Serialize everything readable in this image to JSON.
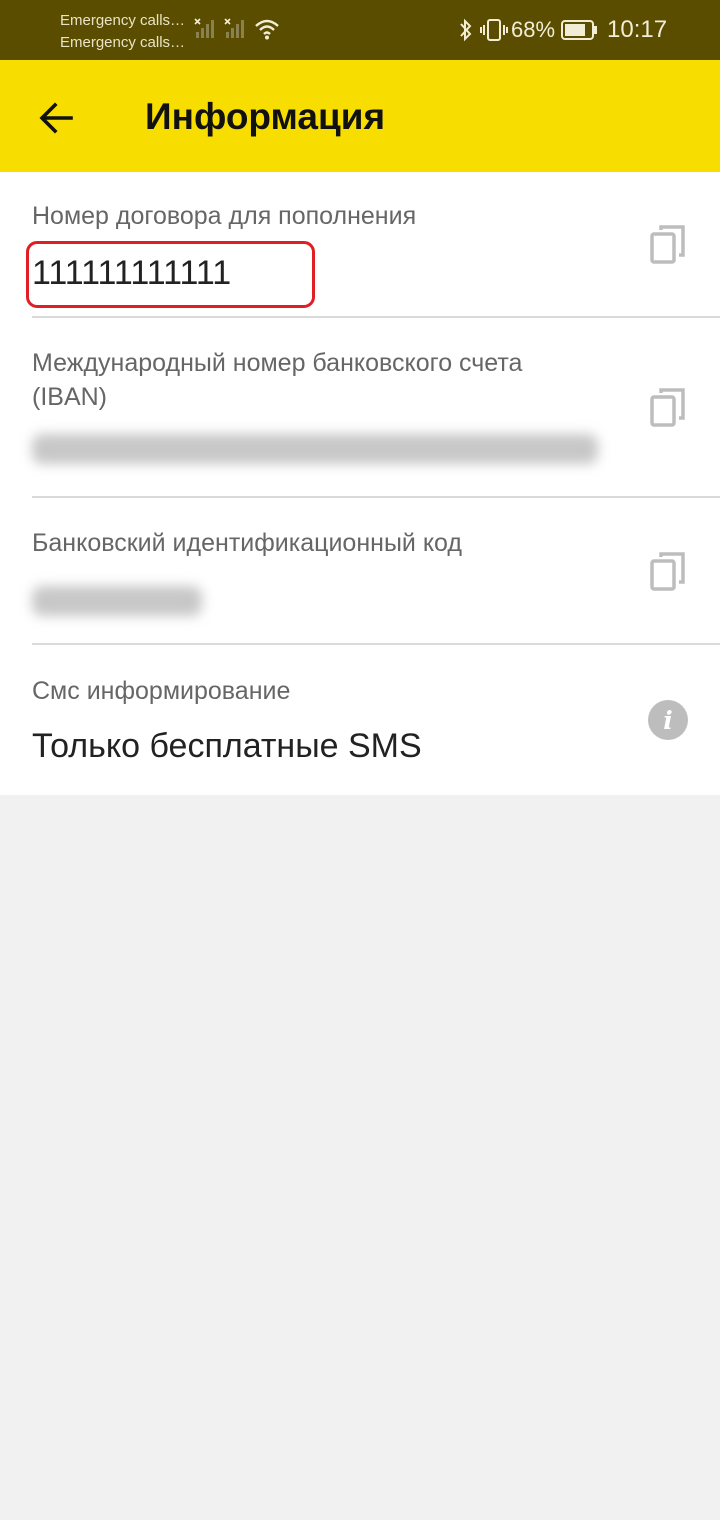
{
  "status_bar": {
    "note_1": "Emergency calls…",
    "note_2": "Emergency calls…",
    "battery_percent": "68%",
    "time": "10:17",
    "icons": [
      "signal-off-icon",
      "signal-off-icon",
      "wifi-icon",
      "bluetooth-icon",
      "vibrate-icon",
      "battery-icon"
    ]
  },
  "app_bar": {
    "title": "Информация",
    "back_icon": "arrow-left-icon",
    "background": "#f7de00"
  },
  "fields": [
    {
      "label": "Номер договора для пополнения",
      "value": "111111111111",
      "action_icon": "copy-icon",
      "highlighted": true
    },
    {
      "label": "Международный номер банковского счета (IBAN)",
      "value_redacted": true,
      "action_icon": "copy-icon"
    },
    {
      "label": "Банковский идентификационный код",
      "value_redacted": true,
      "action_icon": "copy-icon"
    },
    {
      "label": "Смс информирование",
      "value": "Только бесплатные SMS",
      "action_icon": "info-icon"
    }
  ],
  "colors": {
    "status_bar": "#5a4d00",
    "highlight_border": "#e21e25",
    "page_background": "#f1f1f1"
  }
}
